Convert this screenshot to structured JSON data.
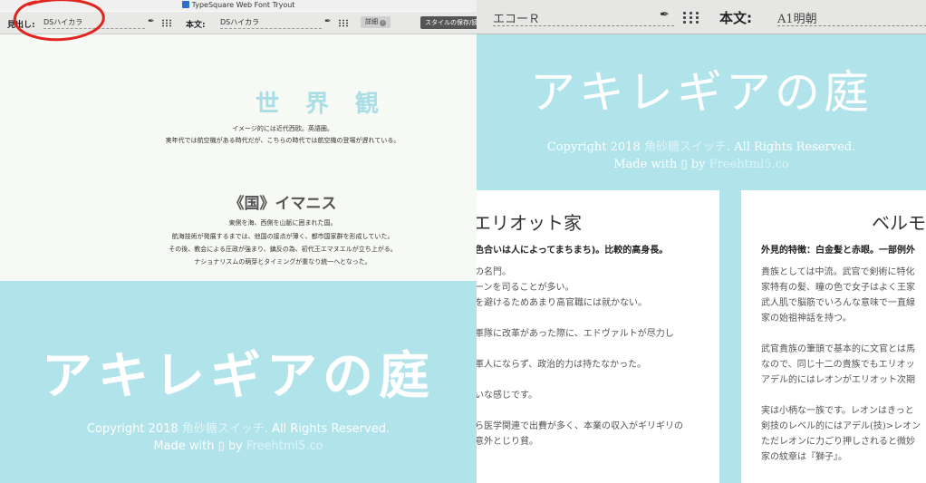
{
  "left": {
    "window_title": "TypeSquare Web Font Tryout",
    "toolbar": {
      "heading_label": "見出し:",
      "heading_font": "DSハイカラ",
      "body_label": "本文:",
      "body_font": "DSハイカラ",
      "detail_label": "詳細",
      "save_label": "スタイルの保存/読"
    },
    "sections": [
      {
        "heading": "世 界 観",
        "lines": [
          "イメージ的には近代西欧。英語圏。",
          "実年代では航空機がある時代だが、こちらの時代では航空機の登場が遅れている。"
        ]
      },
      {
        "heading": "《国》イマニス",
        "lines": [
          "東側を海、西側を山脈に囲まれた国。",
          "航海技術が発展するまでは、他国の接点が薄く、都市国家群を形成していた。",
          "その後、教会による圧政が強まり、鎮反の為、初代王エマヌエルが立ち上がる。",
          "ナショナリスムの萌芽とタイミングが重なり統一へとなった。"
        ]
      }
    ],
    "footer": {
      "title": "アキレギアの庭",
      "copyright_prefix": "Copyright 2018 ",
      "copyright_link": "角砂糖スイッチ",
      "copyright_suffix": ". All Rights Reserved.",
      "made_with": "Made with ▯ by ",
      "made_link": "Freehtml5.co"
    }
  },
  "right": {
    "toolbar": {
      "heading_font": "エコーＲ",
      "body_label": "本文:",
      "body_font": "A1明朝"
    },
    "hero": {
      "title": "アキレギアの庭",
      "copyright_prefix": "Copyright 2018 ",
      "copyright_link": "角砂糖スイッチ",
      "copyright_suffix": ". All Rights Reserved.",
      "made_with": "Made with ▯ by ",
      "made_link": "Freehtml5.co"
    },
    "cards": [
      {
        "title": "エリオット家",
        "feature": "色合いは人によってまちまち)。比較的高身長。",
        "body": "の名門。\nーンを司ることが多い。\nを避けるためあまり高官職には就かない。\n\n軍隊に改革があった際に、エドヴァルトが尽力し\n\n軍人にならず、政治的力は持たなかった。\n\nいな感じです。\n\nら医学関連で出費が多く、本業の収入がギリギリの\n意外とじり貧。"
      },
      {
        "title": "ベルモ",
        "feature": "外見的特徴：白金髪と赤眼。一部例外",
        "body": "貴族としては中流。武官で剣術に特化\n家特有の髪、瞳の色で女子はよく王家\n武人肌で脳筋でいろんな意味で一直線\n家の始祖神話を持つ。\n\n武官貴族の筆頭で基本的に文官とは馬\nなので、同じ十二の貴族でもエリオッ\nアデル的にはレオンがエリオット次期\n\n実は小柄な一族です。レオンはきっと\n剣技のレベル的にはアデル(技)>レオン\nただレオンに力ごり押しされると微妙\n家の紋章は『獅子』。"
      }
    ]
  }
}
